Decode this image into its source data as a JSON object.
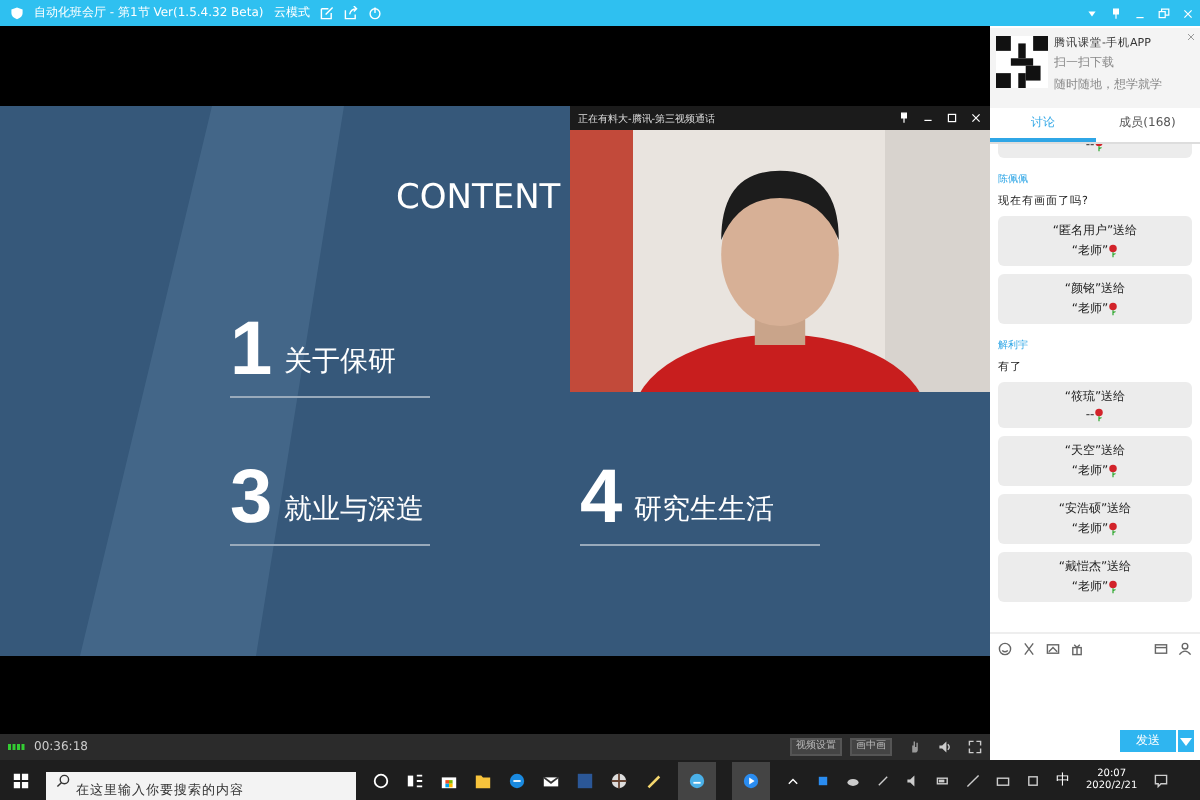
{
  "window": {
    "title": "自动化班会厅 - 第1节 Ver(1.5.4.32 Beta)",
    "mode": "云模式"
  },
  "slide": {
    "heading": "CONTENT",
    "items": [
      {
        "number": "1",
        "label": "关于保研"
      },
      {
        "number": "3",
        "label": "就业与深造"
      },
      {
        "number": "4",
        "label": "研究生生活"
      }
    ]
  },
  "video": {
    "title": "正在有料大-腾讯-第三视频通话"
  },
  "panel": {
    "promo": {
      "title": "腾讯课堂-手机APP",
      "line_1": "扫一扫下载",
      "line_2": "随时随地，想学就学"
    },
    "tabs": [
      {
        "label": "讨论",
        "selected": true
      },
      {
        "label": "成员(168)",
        "selected": false
      }
    ],
    "messages": [
      {
        "kind": "gift",
        "to": "--"
      },
      {
        "kind": "text",
        "name": "陈佩佩",
        "text": "现在有画面了吗?"
      },
      {
        "kind": "gift",
        "from": "“匿名用户”送给",
        "to": "“老师”"
      },
      {
        "kind": "gift",
        "from": "“颜铭”送给",
        "to": "“老师”"
      },
      {
        "kind": "text",
        "name": "解利宇",
        "text": "有了"
      },
      {
        "kind": "gift",
        "from": "“筱琉”送给",
        "to": "--"
      },
      {
        "kind": "gift",
        "from": "“天空”送给",
        "to": "“老师”"
      },
      {
        "kind": "gift",
        "from": "“安浩硕”送给",
        "to": "“老师”"
      },
      {
        "kind": "gift",
        "from": "“戴愷杰”送给",
        "to": "“老师”"
      }
    ],
    "send": "发送"
  },
  "status": {
    "time": "00:36:18",
    "buttons": [
      "视频设置",
      "画中画"
    ]
  },
  "taskbar": {
    "search_placeholder": "在这里输入你要搜索的内容",
    "ime": "中",
    "time": "20:07",
    "date": "2020/2/21"
  }
}
